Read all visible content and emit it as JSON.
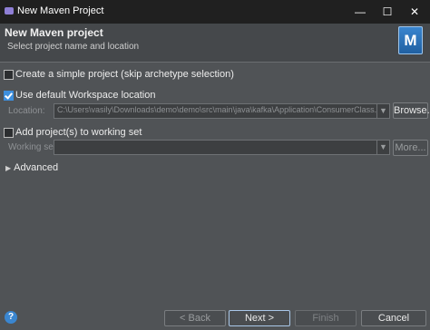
{
  "window": {
    "title": "New Maven Project",
    "minimize": "—",
    "maximize": "☐",
    "close": "✕"
  },
  "header": {
    "title": "New Maven project",
    "subtitle": "Select project name and location",
    "icon_letter": "M"
  },
  "simple_project": {
    "label": "Create a simple project (skip archetype selection)",
    "checked": false
  },
  "default_workspace": {
    "label": "Use default Workspace location",
    "checked": true
  },
  "location": {
    "label": "Location:",
    "value": "C:\\Users\\vasily\\Downloads\\demo\\demo\\src\\main\\java\\kafka\\Application\\ConsumerClass.java",
    "browse": "Browse..."
  },
  "working_set_add": {
    "label": "Add project(s) to working set",
    "checked": false
  },
  "working_set": {
    "label": "Working set:",
    "value": "",
    "more": "More..."
  },
  "advanced": {
    "label": "Advanced"
  },
  "footer": {
    "back": "< Back",
    "next": "Next >",
    "finish": "Finish",
    "cancel": "Cancel",
    "help": "?"
  }
}
